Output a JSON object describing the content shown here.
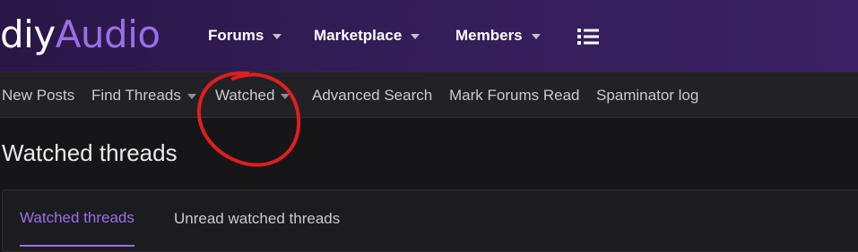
{
  "header": {
    "logo_part1": "diy",
    "logo_part2": "Audio",
    "nav": [
      {
        "label": "Forums"
      },
      {
        "label": "Marketplace"
      },
      {
        "label": "Members"
      }
    ],
    "menu_icon": "list-icon"
  },
  "subnav": {
    "items": [
      {
        "label": "New Posts"
      },
      {
        "label": "Find Threads"
      },
      {
        "label": "Watched"
      },
      {
        "label": "Advanced Search"
      },
      {
        "label": "Mark Forums Read"
      },
      {
        "label": "Spaminator log"
      }
    ]
  },
  "page": {
    "title": "Watched threads"
  },
  "tabs": [
    {
      "label": "Watched threads",
      "active": true
    },
    {
      "label": "Unread watched threads",
      "active": false
    }
  ],
  "colors": {
    "accent": "#9b6ee8",
    "header_bg": "#331d57",
    "annotation": "#e01e1e"
  }
}
